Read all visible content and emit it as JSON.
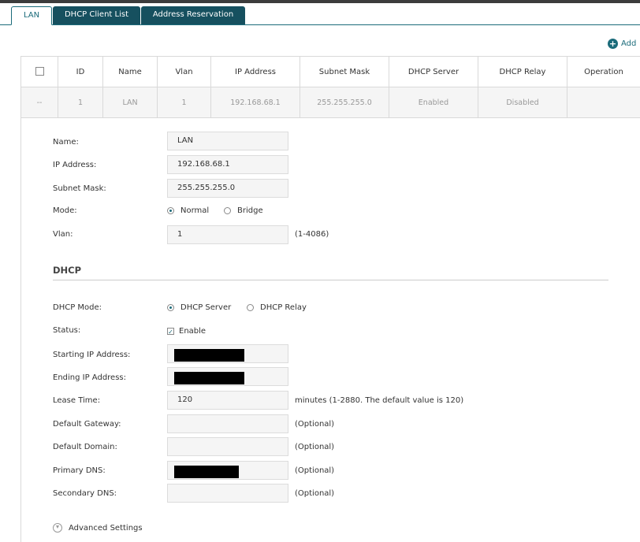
{
  "tabs": [
    {
      "label": "LAN",
      "active": true
    },
    {
      "label": "DHCP Client List",
      "active": false
    },
    {
      "label": "Address Reservation",
      "active": false
    }
  ],
  "add_label": "Add",
  "table": {
    "headers": [
      "ID",
      "Name",
      "Vlan",
      "IP Address",
      "Subnet Mask",
      "DHCP Server",
      "DHCP Relay",
      "Operation"
    ],
    "row": {
      "check": "--",
      "id": "1",
      "name": "LAN",
      "vlan": "1",
      "ip": "192.168.68.1",
      "mask": "255.255.255.0",
      "server": "Enabled",
      "relay": "Disabled",
      "op": ""
    }
  },
  "form": {
    "name_label": "Name:",
    "name_value": "LAN",
    "ip_label": "IP Address:",
    "ip_value": "192.168.68.1",
    "mask_label": "Subnet Mask:",
    "mask_value": "255.255.255.0",
    "mode_label": "Mode:",
    "mode_normal": "Normal",
    "mode_bridge": "Bridge",
    "vlan_label": "Vlan:",
    "vlan_value": "1",
    "vlan_hint": "(1-4086)"
  },
  "dhcp": {
    "section_title": "DHCP",
    "mode_label": "DHCP Mode:",
    "mode_server": "DHCP Server",
    "mode_relay": "DHCP Relay",
    "status_label": "Status:",
    "status_enable": "Enable",
    "start_label": "Starting IP Address:",
    "end_label": "Ending IP Address:",
    "lease_label": "Lease Time:",
    "lease_value": "120",
    "lease_hint": "minutes (1-2880. The default value is 120)",
    "gateway_label": "Default Gateway:",
    "gateway_hint": "(Optional)",
    "domain_label": "Default Domain:",
    "domain_hint": "(Optional)",
    "pdns_label": "Primary DNS:",
    "pdns_hint": "(Optional)",
    "sdns_label": "Secondary DNS:",
    "sdns_hint": "(Optional)"
  },
  "advanced_label": "Advanced Settings",
  "colors": {
    "accent": "#1b6b7a",
    "tab_dark": "#16505f"
  }
}
